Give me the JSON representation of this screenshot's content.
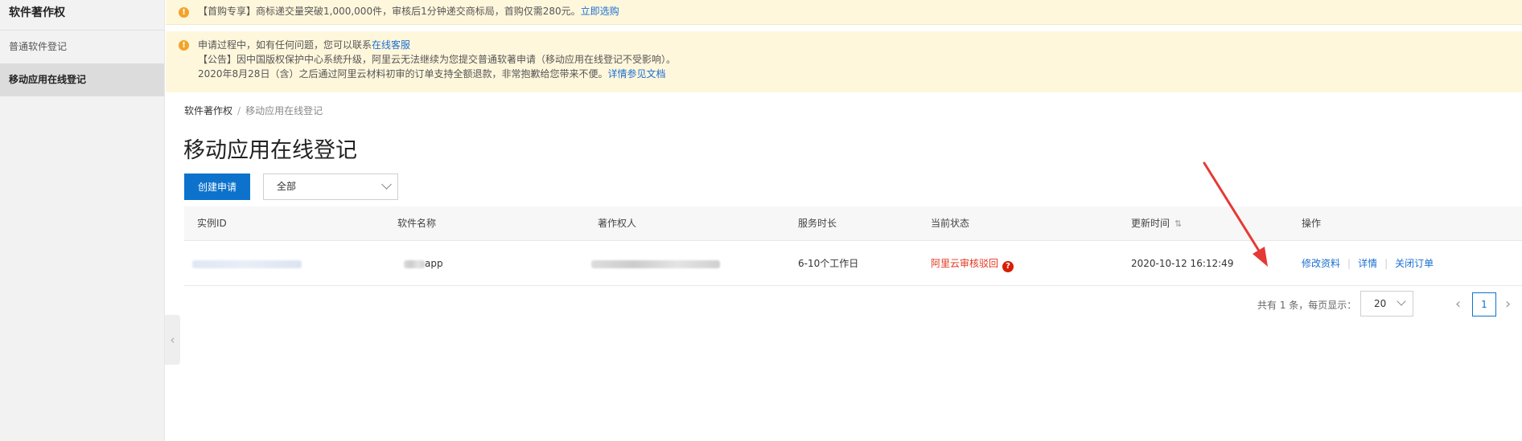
{
  "sidebar": {
    "title": "软件著作权",
    "items": [
      {
        "label": "普通软件登记",
        "active": false
      },
      {
        "label": "移动应用在线登记",
        "active": true
      }
    ]
  },
  "notices": {
    "promo": {
      "text": "【首购专享】商标递交量突破1,000,000件，审核后1分钟递交商标局，首购仅需280元。",
      "link": "立即选购"
    },
    "info": {
      "line1_text": "申请过程中，如有任何问题，您可以联系",
      "line1_link": "在线客服",
      "line2_text": "【公告】因中国版权保护中心系统升级，阿里云无法继续为您提交普通软著申请（移动应用在线登记不受影响）。",
      "line3_text": "2020年8月28日（含）之后通过阿里云材料初审的订单支持全额退款，非常抱歉给您带来不便。",
      "line3_link": "详情参见文档"
    }
  },
  "breadcrumb": {
    "root": "软件著作权",
    "separator": "/",
    "current": "移动应用在线登记"
  },
  "page_title": "移动应用在线登记",
  "toolbar": {
    "create_label": "创建申请",
    "filter_value": "全部"
  },
  "table": {
    "headers": [
      "实例ID",
      "软件名称",
      "著作权人",
      "服务时长",
      "当前状态",
      "更新时间",
      "操作"
    ],
    "rows": [
      {
        "software_name_suffix": "app",
        "service_duration": "6-10个工作日",
        "status": "阿里云审核驳回",
        "updated_at": "2020-10-12 16:12:49",
        "actions": [
          "修改资料",
          "详情",
          "关闭订单"
        ]
      }
    ]
  },
  "pagination": {
    "total_text": "共有 1 条，每页显示：",
    "page_size": "20",
    "current_page": "1"
  },
  "colors": {
    "primary": "#0d72cc",
    "link": "#1b6fd1",
    "danger": "#e2351e",
    "notice_bg": "#fff7dc",
    "annotation": "#e53935"
  }
}
